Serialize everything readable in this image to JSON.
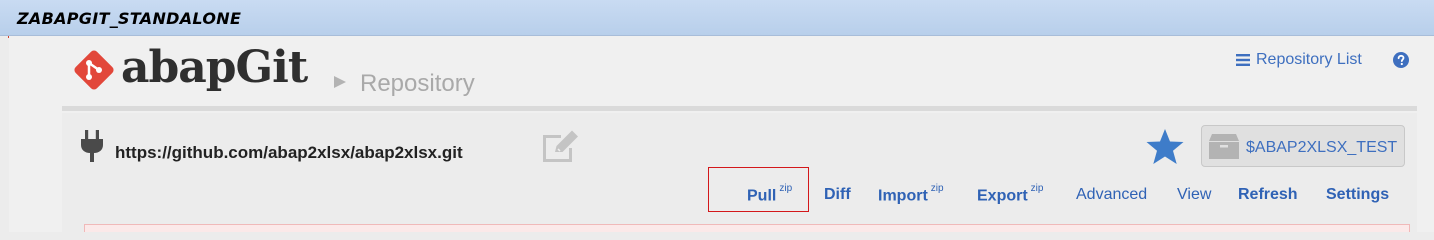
{
  "window": {
    "title": "ZABAPGIT_STANDALONE"
  },
  "header": {
    "brand": "abapGit",
    "breadcrumb": "Repository",
    "repo_list_label": "Repository List",
    "icons": {
      "logo": "abapgit-logo-icon",
      "menu": "hamburger-menu-icon",
      "help": "question-circle-icon",
      "breadcrumb_arrow": "triangle-right-icon"
    }
  },
  "repo": {
    "url": "https://github.com/abap2xlsx/abap2xlsx.git",
    "package": "$ABAP2XLSX_TEST",
    "icons": {
      "type": "plug-icon",
      "edit": "edit-icon",
      "favorite": "star-icon",
      "package": "package-box-icon"
    }
  },
  "toolbar": {
    "items": [
      {
        "label": "Pull",
        "sup": "zip"
      },
      {
        "label": "Diff"
      },
      {
        "label": "Import",
        "sup": "zip"
      },
      {
        "label": "Export",
        "sup": "zip"
      },
      {
        "label": "Advanced"
      },
      {
        "label": "View"
      },
      {
        "label": "Refresh"
      },
      {
        "label": "Settings"
      }
    ]
  },
  "colors": {
    "link": "#2f62b5",
    "brand_red": "#e2473a",
    "star_blue": "#3e7cc9",
    "highlight_red": "#d3171a",
    "titlebar": "#c9dbf2"
  }
}
